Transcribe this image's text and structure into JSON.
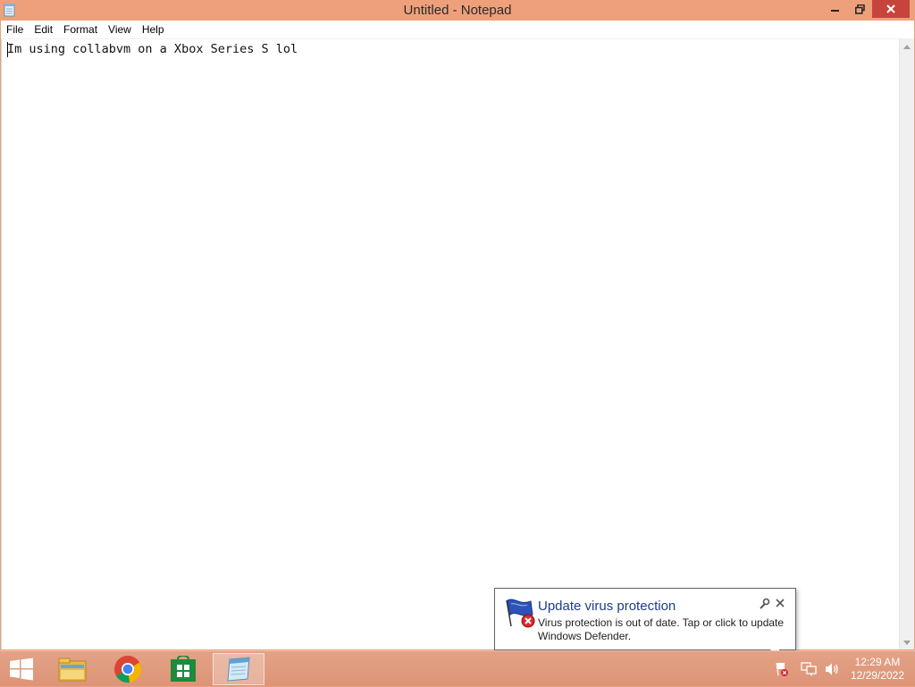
{
  "window": {
    "title": "Untitled - Notepad",
    "icon": "notepad-icon",
    "controls": [
      "minimize-icon",
      "restore-icon",
      "close-icon"
    ],
    "close_color": "#c7443c",
    "frame_color": "#ec9f79"
  },
  "menubar": {
    "items": [
      "File",
      "Edit",
      "Format",
      "View",
      "Help"
    ]
  },
  "editor": {
    "content": "Im using collabvm on a Xbox Series S lol"
  },
  "taskbar": {
    "start_icon": "windows-logo-icon",
    "pinned": [
      {
        "name": "file-explorer",
        "icon": "folder-icon"
      },
      {
        "name": "google-chrome",
        "icon": "chrome-icon"
      },
      {
        "name": "windows-store",
        "icon": "store-icon"
      },
      {
        "name": "notepad",
        "icon": "notepad-icon",
        "active": true
      }
    ],
    "tray_icons": [
      "defender-alert-icon",
      "network-icon",
      "volume-icon"
    ],
    "clock": {
      "time": "12:29 AM",
      "date": "12/29/2022"
    }
  },
  "notification": {
    "icon": "security-flag-icon",
    "title": "Update virus protection",
    "body": "Virus protection is out of date. Tap or click to update Windows Defender.",
    "title_color": "#1c3c8e"
  }
}
